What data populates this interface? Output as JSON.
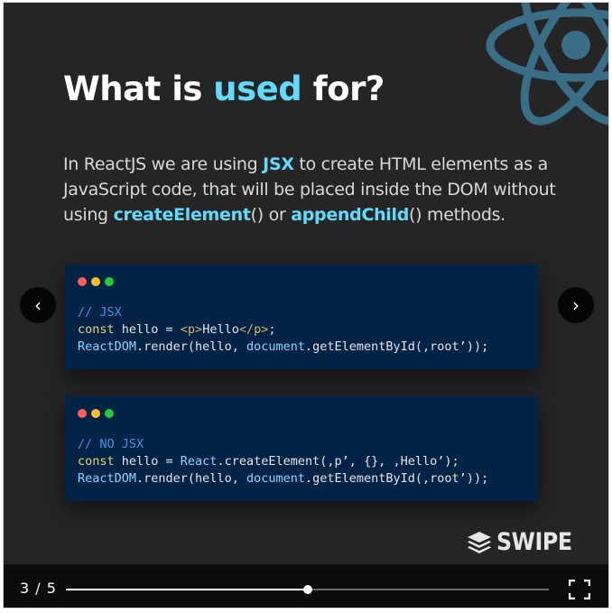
{
  "slide": {
    "title": {
      "before": "What is ",
      "accent": "used",
      "after": " for?"
    },
    "intro": {
      "p1": "In ReactJS we are using ",
      "k1": "JSX",
      "p2": " to create HTML elements as a JavaScript code, that will be placed inside the DOM without using ",
      "k2": "createElement",
      "p3": "() or ",
      "k3": "appendChild",
      "p4": "() methods."
    },
    "code_blocks": [
      {
        "comment": "// JSX",
        "line2": {
          "keyword": "const",
          "rest": " hello = ",
          "tag": "<p>",
          "text": "Hello",
          "close": "</p>",
          "end": ";"
        },
        "line3": {
          "obj": "ReactDOM",
          "rest": ".render(hello, ",
          "doc": "document",
          "call": ".getElementById(",
          "arg": ",root’",
          "end": "));"
        }
      },
      {
        "comment": "// NO JSX",
        "line2": {
          "keyword": "const",
          "rest": " hello = ",
          "obj": "React",
          "call": ".createElement(",
          "args": ",p’, {}, ,Hello’",
          "end": ");"
        },
        "line3": {
          "obj": "ReactDOM",
          "rest": ".render(hello, ",
          "doc": "document",
          "call": ".getElementById(",
          "arg": ",root’",
          "end": "));"
        }
      }
    ],
    "swipe_label": "SWIPE"
  },
  "nav": {
    "prev_symbol": "‹",
    "next_symbol": "›"
  },
  "controls": {
    "counter": "3 / 5",
    "progress_fraction": 0.5,
    "fullscreen_icon": "fullscreen-icon"
  },
  "colors": {
    "accent": "#61dafb",
    "code_bg": "#012345",
    "slide_bg": "#252525"
  }
}
